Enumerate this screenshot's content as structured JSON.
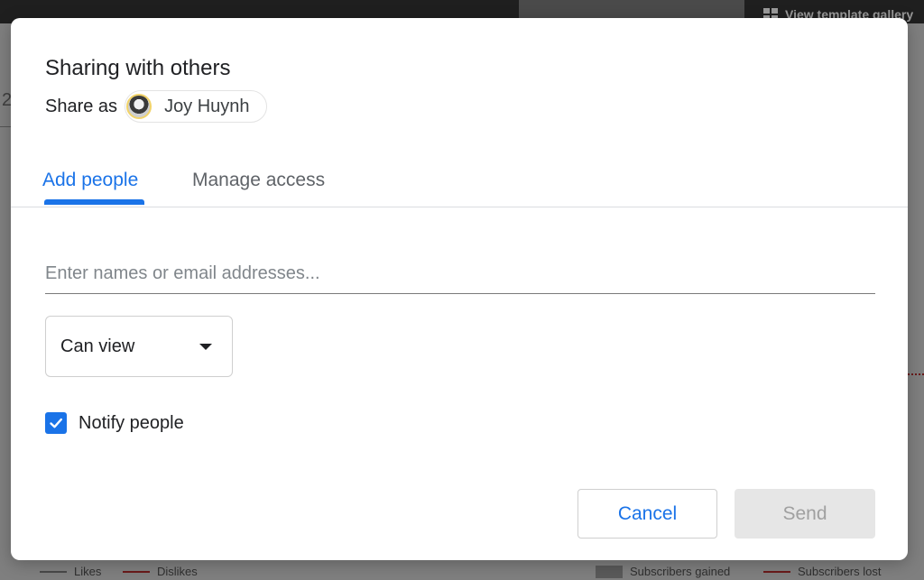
{
  "background": {
    "template_link": "View template gallery",
    "edge_number": "2",
    "legend": [
      {
        "label": "Likes",
        "color": "#4a4a4a",
        "kind": "line"
      },
      {
        "label": "Dislikes",
        "color": "#6a1a1a",
        "kind": "line"
      },
      {
        "label": "Subscribers gained",
        "color": "#5a5a5a",
        "kind": "box"
      },
      {
        "label": "Subscribers lost",
        "color": "#6a1a1a",
        "kind": "line"
      }
    ]
  },
  "dialog": {
    "title": "Sharing with others",
    "share_as_label": "Share as",
    "user_name": "Joy Huynh",
    "tabs": [
      {
        "label": "Add people",
        "active": true
      },
      {
        "label": "Manage access",
        "active": false
      }
    ],
    "email_placeholder": "Enter names or email addresses...",
    "permission": {
      "selected": "Can view"
    },
    "notify": {
      "label": "Notify people",
      "checked": true
    },
    "buttons": {
      "cancel": "Cancel",
      "send": "Send"
    }
  },
  "colors": {
    "accent": "#1a73e8",
    "disabled_bg": "#e6e6e6",
    "disabled_text": "#a0a0a0"
  }
}
